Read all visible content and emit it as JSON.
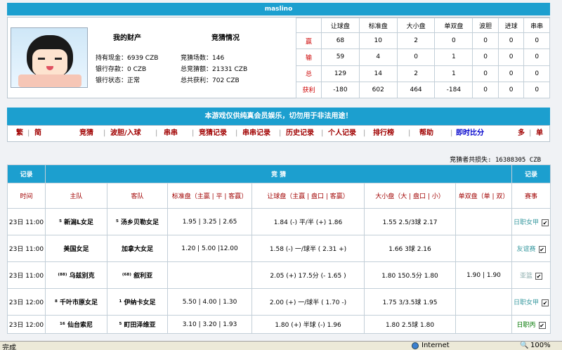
{
  "user": {
    "name": "maslino"
  },
  "info": {
    "title_left": "我的财产",
    "title_right": "竞猜情况",
    "cash_label": "持有现金：",
    "cash": "6939 CZB",
    "bank_label": "银行存款：",
    "bank": "0 CZB",
    "bank_status_label": "银行状态：",
    "bank_status": "正常",
    "count_label": "竞猜场数：",
    "count": "146",
    "total_label": "总竞猜额：",
    "total": "21331 CZB",
    "profit_label": "总共获利：",
    "profit": "702 CZB"
  },
  "stats": {
    "headers": [
      "让球盘",
      "标准盘",
      "大小盘",
      "单双盘",
      "波胆",
      "进球",
      "串串"
    ],
    "rows": [
      {
        "label": "赢",
        "values": [
          "68",
          "10",
          "2",
          "0",
          "0",
          "0",
          "0"
        ]
      },
      {
        "label": "输",
        "values": [
          "59",
          "4",
          "0",
          "1",
          "0",
          "0",
          "0"
        ]
      },
      {
        "label": "总",
        "values": [
          "129",
          "14",
          "2",
          "1",
          "0",
          "0",
          "0"
        ]
      },
      {
        "label": "获利",
        "values": [
          "-180",
          "602",
          "464",
          "-184",
          "0",
          "0",
          "0"
        ]
      }
    ]
  },
  "notice": "本游戏仅供纯真会员娱乐，切勿用于非法用途！",
  "nav": {
    "items": [
      "繁",
      "简",
      "竞猜",
      "波胆/入球",
      "串串",
      "竞猜记录",
      "串串记录",
      "历史记录",
      "个人记录",
      "排行榜",
      "帮助",
      "即时比分",
      "多",
      "单"
    ]
  },
  "loss_text": "竞猜者共损失: 16388305 CZB",
  "table": {
    "record_label": "记录",
    "title": "竞  猜",
    "record_label2": "记录",
    "headers": [
      "时间",
      "主队",
      "客队",
      "标准盘（主赢 | 平 | 客赢）",
      "让球盘（主赢 | 盘口 | 客赢）",
      "大小盘（大 | 盘口 | 小）",
      "单双盘（单 | 双）",
      "赛事"
    ],
    "rows": [
      {
        "time": "23日 11:00",
        "home": "⁵ 新潟L女足",
        "away": "⁵ 汤乡贝勒女足",
        "std": "1.95 | 3.25 | 2.65",
        "hdp": "1.84 (-) 平/半 (+) 1.86",
        "ou": "1.55 2.5/3球 2.17",
        "oe": "",
        "league": "日职女甲",
        "lc": "teal"
      },
      {
        "time": "23日 11:00",
        "home": "美国女足",
        "away": "加拿大女足",
        "std": "1.20 | 5.00 |12.00",
        "hdp": "1.58 (-) 一/球半 ( 2.31 +)",
        "ou": "1.66 3球 2.16",
        "oe": "",
        "league": "友谊赛",
        "lc": "teal"
      },
      {
        "time": "23日 11:00",
        "home": "⁽⁸⁸⁾ 乌兹别克",
        "away": "⁽⁶⁸⁾ 叙利亚",
        "std": "",
        "hdp": "2.05 (+) 17.5分 (- 1.65 )",
        "ou": "1.80 150.5分 1.80",
        "oe": "1.90 | 1.90",
        "league": "亚篮",
        "lc": "gray"
      },
      {
        "time": "23日 12:00",
        "home": "⁸ 千叶市原女足",
        "away": "¹ 伊纳卡女足",
        "std": "5.50 | 4.00 | 1.30",
        "hdp": "2.00 (+) 一/球半 ( 1.70 -)",
        "ou": "1.75 3/3.5球 1.95",
        "oe": "",
        "league": "日职女甲",
        "lc": "teal"
      },
      {
        "time": "23日 12:00",
        "home": "¹⁶ 仙台索尼",
        "away": "⁵ 町田泽维亚",
        "std": "3.10 | 3.20 | 1.93",
        "hdp": "1.80 (+) 半球 (-) 1.96",
        "ou": "1.80 2.5球 1.80",
        "oe": "",
        "league": "日职丙",
        "lc": "grn"
      }
    ]
  },
  "status": {
    "left": "完成",
    "zone": "Internet",
    "zoom": "100%"
  }
}
